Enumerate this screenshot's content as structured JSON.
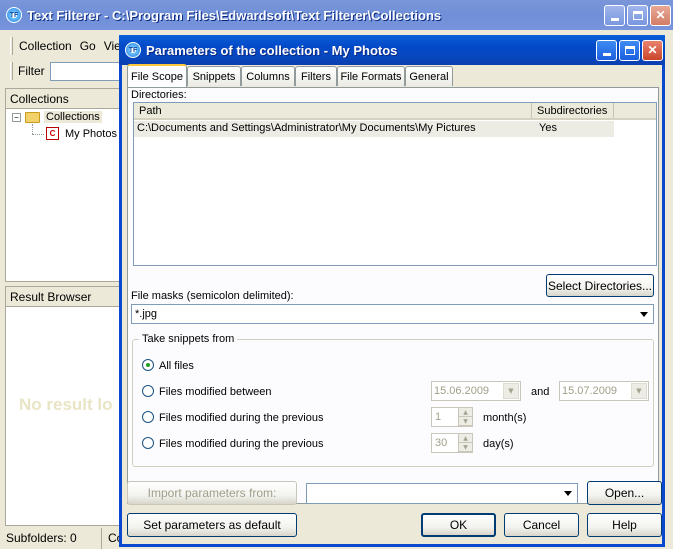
{
  "main_window": {
    "title": "Text Filterer - C:\\Program Files\\Edwardsoft\\Text Filterer\\Collections",
    "menu": [
      "Collection",
      "Go",
      "Vie"
    ],
    "filter_label": "Filter",
    "collections_header": "Collections",
    "tree": [
      {
        "label": "Collections",
        "icon": "folder-icon"
      },
      {
        "label": "My Photos",
        "icon": "collection-icon"
      }
    ],
    "result_browser_header": "Result Browser",
    "no_result_text": "No result lo",
    "status": [
      "Subfolders: 0",
      "Co"
    ]
  },
  "dialog": {
    "title": "Parameters of the collection - My Photos",
    "tabs": [
      "File Scope",
      "Snippets",
      "Columns",
      "Filters",
      "File Formats",
      "General"
    ],
    "active_tab": "File Scope",
    "directories_label": "Directories:",
    "columns": [
      "Path",
      "Subdirectories"
    ],
    "rows": [
      {
        "path": "C:\\Documents and Settings\\Administrator\\My Documents\\My Pictures",
        "subdirs": "Yes"
      }
    ],
    "select_dirs_button": "Select Directories...",
    "file_masks_label": "File masks (semicolon delimited):",
    "file_masks_value": "*.jpg",
    "snippets_group": "Take snippets from",
    "options": {
      "all_files": "All files",
      "modified_between": "Files modified between",
      "modified_months": "Files modified during the previous",
      "modified_days": "Files modified during the previous"
    },
    "date_from": "15.06.2009",
    "and_label": "and",
    "date_to": "15.07.2009",
    "months_value": "1",
    "months_label": "month(s)",
    "days_value": "30",
    "days_label": "day(s)",
    "import_button": "Import parameters from:",
    "open_button": "Open...",
    "set_default_button": "Set parameters as default",
    "ok_button": "OK",
    "cancel_button": "Cancel",
    "help_button": "Help"
  },
  "colors": {
    "titlebar_active": "#0348c7",
    "titlebar_inactive": "#7b96d9",
    "dialog_face": "#ece9d8",
    "tab_highlight": "#ffc83c"
  }
}
